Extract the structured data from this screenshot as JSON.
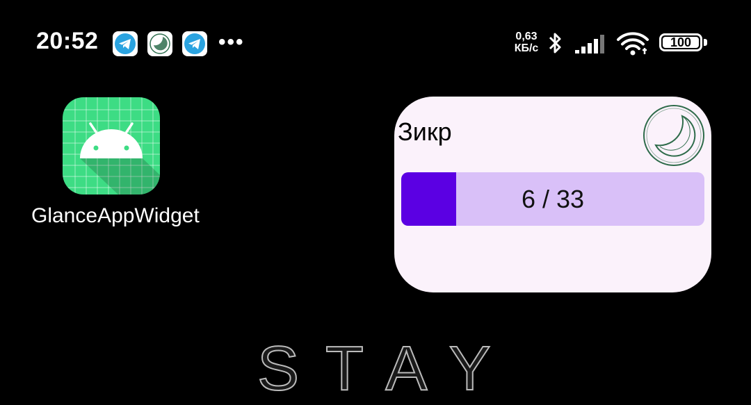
{
  "status_bar": {
    "time": "20:52",
    "notifications": [
      {
        "icon": "telegram-icon"
      },
      {
        "icon": "zikr-app-icon"
      },
      {
        "icon": "telegram-icon"
      }
    ],
    "overflow": "•••",
    "net_speed_value": "0,63",
    "net_speed_unit": "КБ/с",
    "battery_level": "100"
  },
  "home": {
    "app": {
      "label": "GlanceAppWidget",
      "icon": "android-icon",
      "icon_color": "#3ddc84"
    },
    "wallpaper_text": "STAY"
  },
  "widget": {
    "title": "Зикр",
    "counter_text": "6 / 33",
    "progress": {
      "current": 6,
      "total": 33
    },
    "colors": {
      "background": "#fbf2fb",
      "track": "#d9c0f8",
      "fill": "#5b00e3"
    },
    "logo_icon": "crescent-moon-icon"
  }
}
